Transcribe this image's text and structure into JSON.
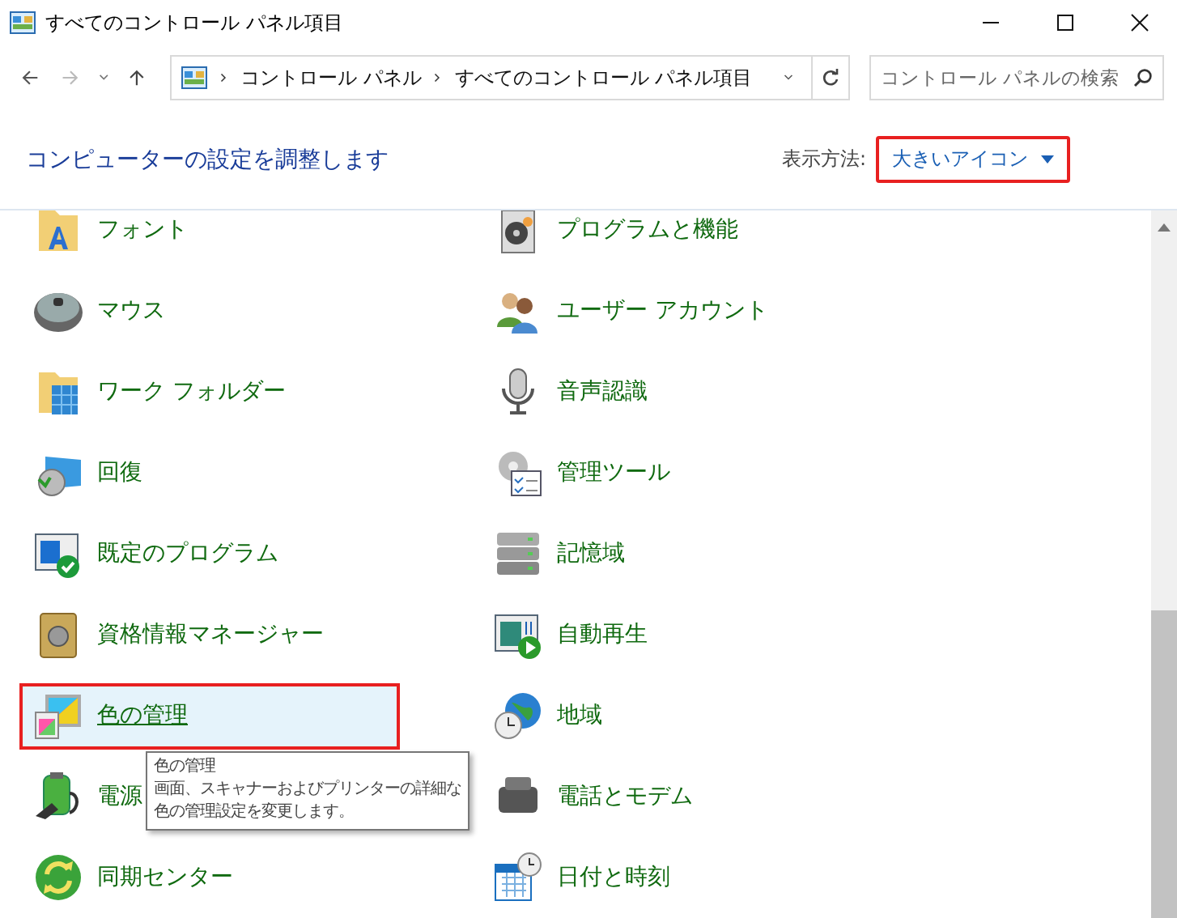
{
  "window": {
    "title": "すべてのコントロール パネル項目"
  },
  "address": {
    "crumbs": [
      "コントロール パネル",
      "すべてのコントロール パネル項目"
    ]
  },
  "search": {
    "placeholder": "コントロール パネルの検索"
  },
  "header": {
    "title": "コンピューターの設定を調整します",
    "view_label": "表示方法:",
    "view_value": "大きいアイコン",
    "view_highlighted": true
  },
  "items": [
    {
      "label": "フォント",
      "selected": false
    },
    {
      "label": "プログラムと機能",
      "selected": false
    },
    {
      "label": "マウス",
      "selected": false
    },
    {
      "label": "ユーザー アカウント",
      "selected": false
    },
    {
      "label": "ワーク フォルダー",
      "selected": false
    },
    {
      "label": "音声認識",
      "selected": false
    },
    {
      "label": "回復",
      "selected": false
    },
    {
      "label": "管理ツール",
      "selected": false
    },
    {
      "label": "既定のプログラム",
      "selected": false
    },
    {
      "label": "記憶域",
      "selected": false
    },
    {
      "label": "資格情報マネージャー",
      "selected": false
    },
    {
      "label": "自動再生",
      "selected": false
    },
    {
      "label": "色の管理",
      "selected": true
    },
    {
      "label": "地域",
      "selected": false
    },
    {
      "label": "電源",
      "selected": false
    },
    {
      "label": "電話とモデム",
      "selected": false
    },
    {
      "label": "同期センター",
      "selected": false
    },
    {
      "label": "日付と時刻",
      "selected": false
    }
  ],
  "tooltip": {
    "title": "色の管理",
    "lines": [
      "画面、スキャナーおよびプリンターの詳細な",
      "色の管理設定を変更します。"
    ]
  }
}
